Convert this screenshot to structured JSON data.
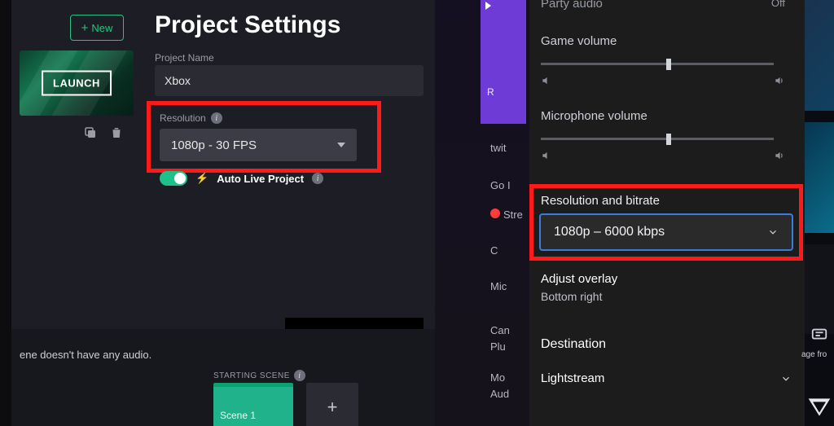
{
  "left": {
    "new_label": "New",
    "launch_label": "LAUNCH",
    "title": "Project Settings",
    "project_name_label": "Project Name",
    "project_name_value": "Xbox",
    "resolution_label": "Resolution",
    "resolution_value": "1080p - 30 FPS",
    "auto_live_label": "Auto Live Project",
    "audio_msg": "ene doesn't have any audio.",
    "starting_scene_label": "STARTING SCENE",
    "scene1_label": "Scene 1"
  },
  "center": {
    "items": {
      "twit": "twit",
      "go": "Go I",
      "stre": "Stre",
      "c": "C",
      "mic": "Mic",
      "cam": "Can",
      "plu": "Plu",
      "mo": "Mo",
      "aud": "Aud"
    }
  },
  "right": {
    "party_audio_label": "Party audio",
    "party_audio_value": "Off",
    "game_volume_label": "Game volume",
    "mic_volume_label": "Microphone volume",
    "res_bitrate_label": "Resolution and bitrate",
    "res_bitrate_value": "1080p – 6000 kbps",
    "adjust_overlay_label": "Adjust overlay",
    "adjust_overlay_value": "Bottom right",
    "destination_label": "Destination",
    "lightstream_label": "Lightstream",
    "game_volume_pct": 54,
    "mic_volume_pct": 54
  },
  "edge": {
    "age": "age fro"
  }
}
